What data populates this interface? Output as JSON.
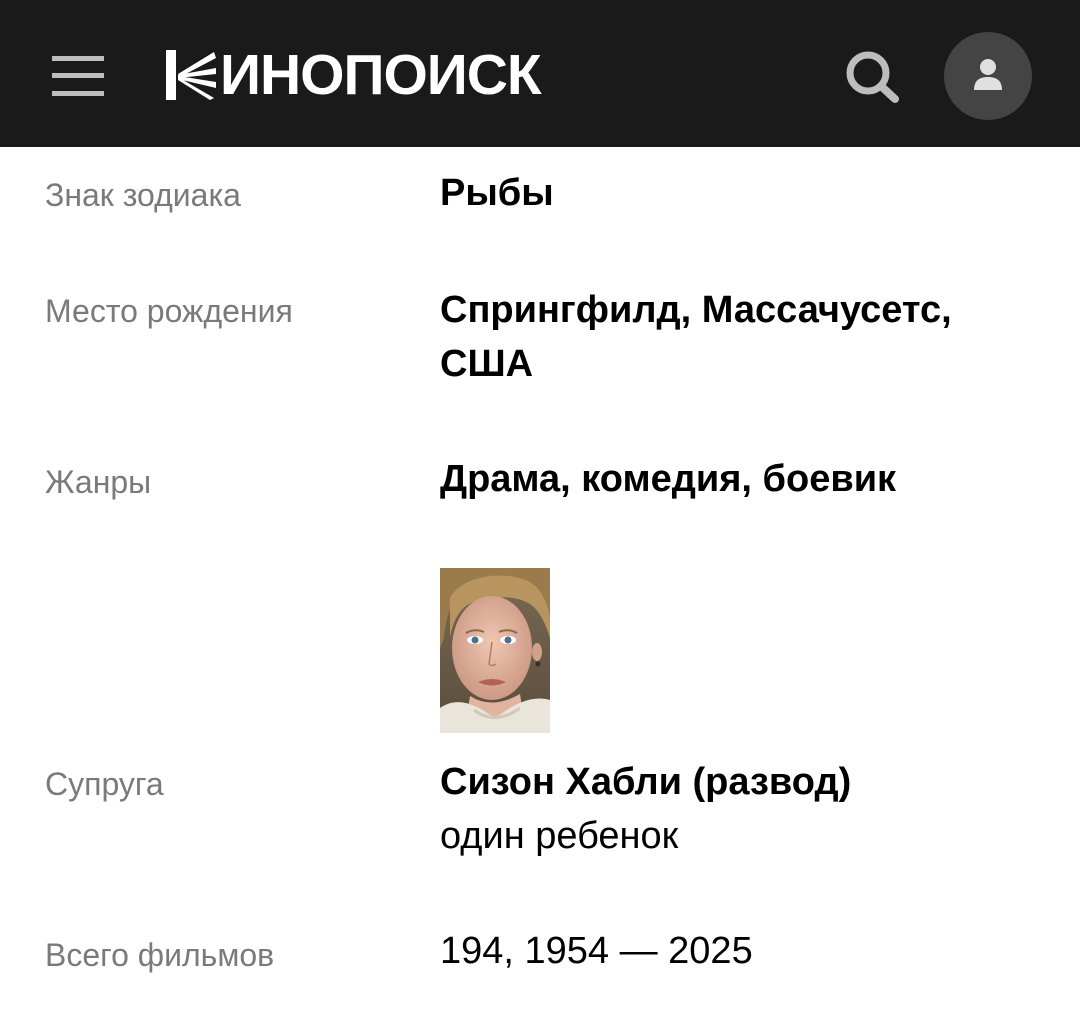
{
  "header": {
    "logo_text": "ИНОПОИСК",
    "logo_alt": "Кинопоиск",
    "background": "#1a1a1a",
    "icons": {
      "menu": "menu-icon",
      "search": "search-icon",
      "profile": "profile-icon"
    }
  },
  "details": {
    "zodiac": {
      "label": "Знак зодиака",
      "value": "Рыбы"
    },
    "birthplace": {
      "label": "Место рождения",
      "value_line1": "Спрингфилд, Массачусетс,",
      "value_line2": "США"
    },
    "genres": {
      "label": "Жанры",
      "value": "Драма, комедия, боевик"
    },
    "spouse": {
      "label": "Супруга",
      "name": "Сизон Хабли (развод)",
      "children": "один ребенок"
    },
    "films": {
      "label": "Всего фильмов",
      "value": "194, 1954 — 2025"
    }
  },
  "colors": {
    "label": "#7a7a7a",
    "value": "#000000",
    "icon_grey": "#bdbdbd",
    "avatar_bg": "#444444"
  }
}
